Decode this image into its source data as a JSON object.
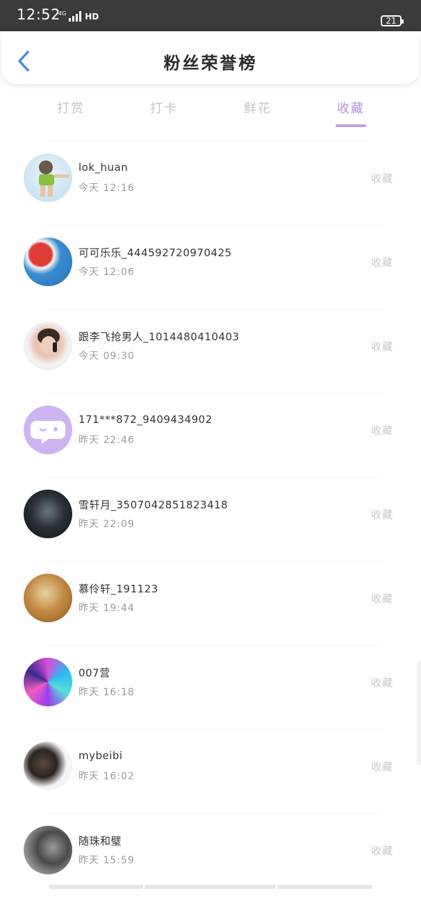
{
  "status_bar": {
    "time": "12:52",
    "network_small": "4G",
    "network_label": "HD",
    "battery": "21"
  },
  "header": {
    "title": "粉丝荣誉榜"
  },
  "tabs": [
    {
      "label": "打赏",
      "active": false
    },
    {
      "label": "打卡",
      "active": false
    },
    {
      "label": "鲜花",
      "active": false
    },
    {
      "label": "收藏",
      "active": true
    }
  ],
  "list": [
    {
      "name": "lok_huan",
      "time": "今天 12:16",
      "action": "收藏"
    },
    {
      "name": "可可乐乐_444592720970425",
      "time": "今天 12:06",
      "action": "收藏"
    },
    {
      "name": "跟李飞抢男人_1014480410403",
      "time": "今天 09:30",
      "action": "收藏"
    },
    {
      "name": "171***872_9409434902",
      "time": "昨天 22:46",
      "action": "收藏"
    },
    {
      "name": "雪轩月_3507042851823418",
      "time": "昨天 22:09",
      "action": "收藏"
    },
    {
      "name": "慕伶轩_191123",
      "time": "昨天 19:44",
      "action": "收藏"
    },
    {
      "name": "007营",
      "time": "昨天 16:18",
      "action": "收藏"
    },
    {
      "name": "mybeibi",
      "time": "昨天 16:02",
      "action": "收藏"
    },
    {
      "name": "随珠和璧",
      "time": "昨天 15:59",
      "action": "收藏"
    }
  ],
  "colors": {
    "accent": "#b58fe3",
    "back_icon": "#3b8fe0",
    "muted_text": "#999999"
  }
}
